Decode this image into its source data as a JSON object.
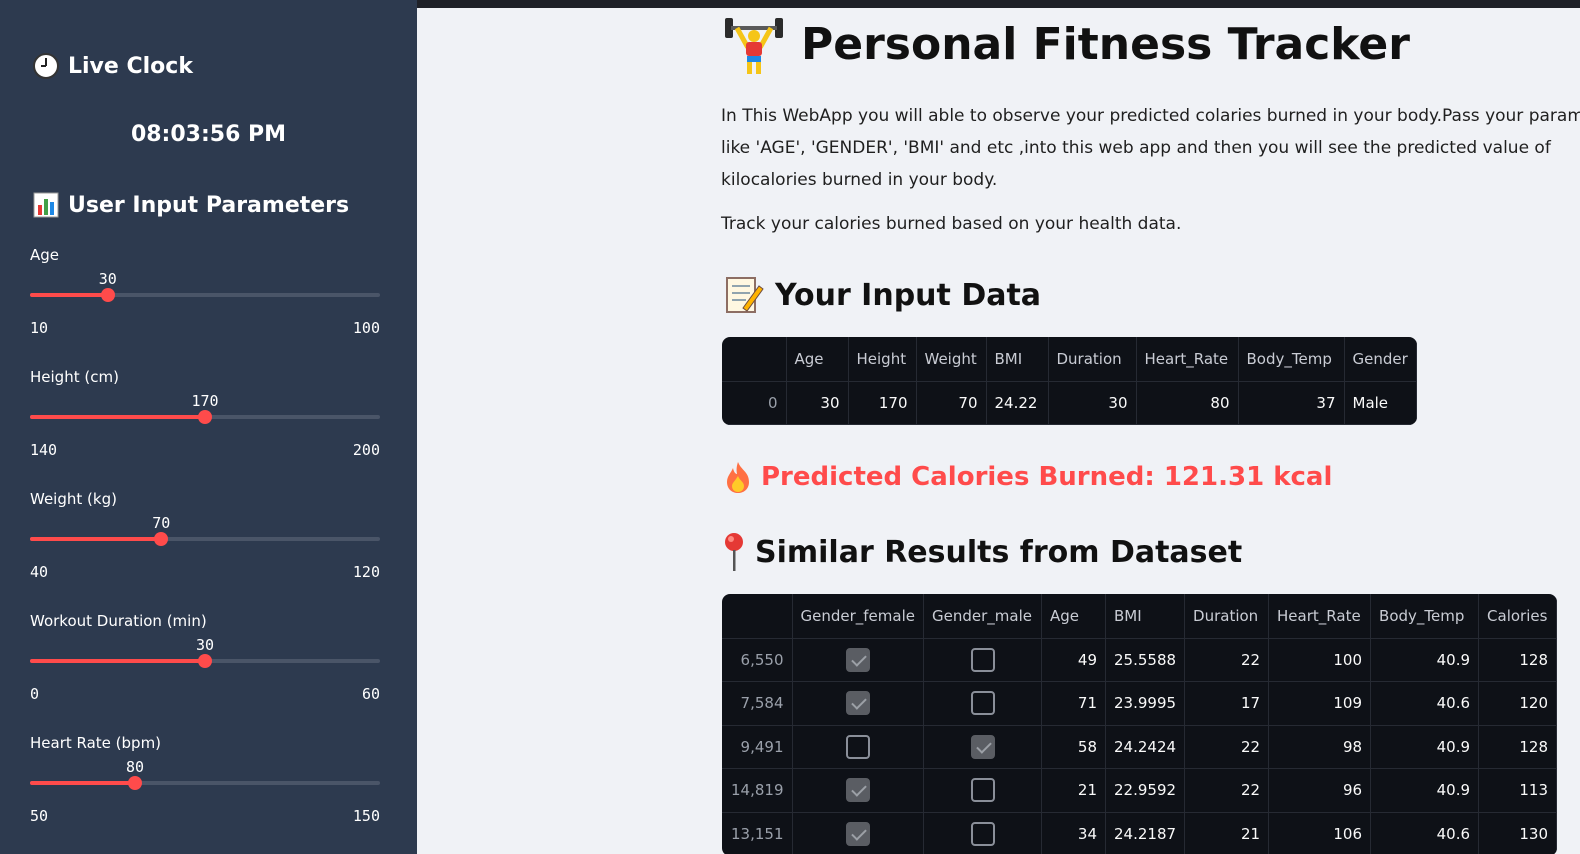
{
  "sidebar": {
    "clock_heading": "Live Clock",
    "clock_time": "08:03:56 PM",
    "params_heading": "User Input Parameters",
    "sliders": [
      {
        "label": "Age",
        "value": 30,
        "min": 10,
        "max": 100
      },
      {
        "label": "Height (cm)",
        "value": 170,
        "min": 140,
        "max": 200
      },
      {
        "label": "Weight (kg)",
        "value": 70,
        "min": 40,
        "max": 120
      },
      {
        "label": "Workout Duration (min)",
        "value": 30,
        "min": 0,
        "max": 60
      },
      {
        "label": "Heart Rate (bpm)",
        "value": 80,
        "min": 50,
        "max": 150
      }
    ]
  },
  "main": {
    "title": "Personal Fitness Tracker",
    "intro_lines": [
      "In This WebApp you will able to observe your predicted colaries burned in your body.Pass your paramet",
      "like 'AGE', 'GENDER', 'BMI' and etc ,into this web app and then you will see the predicted value of",
      "kilocalories burned in your body."
    ],
    "subtext": "Track your calories burned based on your health data.",
    "input_heading": "Your Input Data",
    "input_table": {
      "columns": [
        "",
        "Age",
        "Height",
        "Weight",
        "BMI",
        "Duration",
        "Heart_Rate",
        "Body_Temp",
        "Gender"
      ],
      "rows": [
        [
          "0",
          "30",
          "170",
          "70",
          "24.22",
          "30",
          "80",
          "37",
          "Male"
        ]
      ]
    },
    "predicted_text": "Predicted Calories Burned: 121.31 kcal",
    "similar_heading": "Similar Results from Dataset",
    "similar_table": {
      "columns": [
        "",
        "Gender_female",
        "Gender_male",
        "Age",
        "BMI",
        "Duration",
        "Heart_Rate",
        "Body_Temp",
        "Calories"
      ],
      "rows": [
        {
          "index": "6,550",
          "female": true,
          "male": false,
          "age": "49",
          "bmi": "25.5588",
          "duration": "22",
          "heart_rate": "100",
          "body_temp": "40.9",
          "calories": "128"
        },
        {
          "index": "7,584",
          "female": true,
          "male": false,
          "age": "71",
          "bmi": "23.9995",
          "duration": "17",
          "heart_rate": "109",
          "body_temp": "40.6",
          "calories": "120"
        },
        {
          "index": "9,491",
          "female": false,
          "male": true,
          "age": "58",
          "bmi": "24.2424",
          "duration": "22",
          "heart_rate": "98",
          "body_temp": "40.9",
          "calories": "128"
        },
        {
          "index": "14,819",
          "female": true,
          "male": false,
          "age": "21",
          "bmi": "22.9592",
          "duration": "22",
          "heart_rate": "96",
          "body_temp": "40.9",
          "calories": "113"
        },
        {
          "index": "13,151",
          "female": true,
          "male": false,
          "age": "34",
          "bmi": "24.2187",
          "duration": "21",
          "heart_rate": "106",
          "body_temp": "40.6",
          "calories": "130"
        }
      ]
    }
  }
}
